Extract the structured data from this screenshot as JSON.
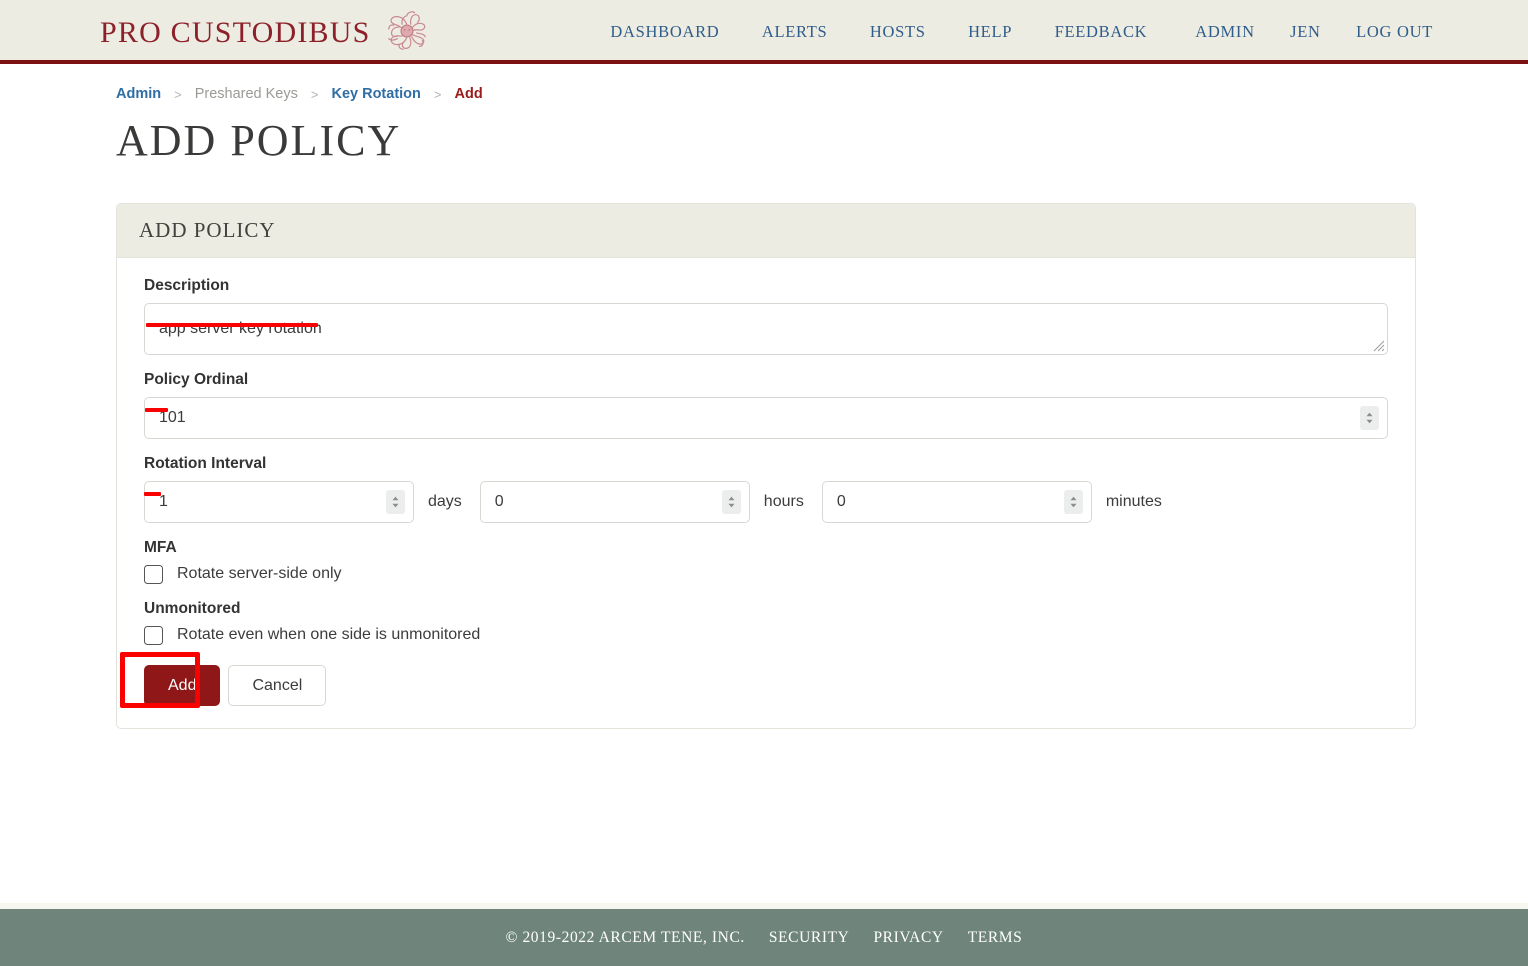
{
  "header": {
    "brand_name": "PRO CUSTODIBUS",
    "logo_icon": "medusa-head-icon",
    "nav_main": [
      {
        "label": "DASHBOARD"
      },
      {
        "label": "ALERTS"
      },
      {
        "label": "HOSTS"
      },
      {
        "label": "HELP"
      },
      {
        "label": "FEEDBACK"
      }
    ],
    "nav_user": [
      {
        "label": "ADMIN"
      },
      {
        "label": "JEN"
      },
      {
        "label": "LOG OUT"
      }
    ],
    "colors": {
      "background": "#edece3",
      "accent": "#7b1113",
      "brand_text": "#8d2129",
      "nav_link": "#2f5d8a"
    }
  },
  "breadcrumb": {
    "separator": ">",
    "items": [
      {
        "label": "Admin",
        "style": "link"
      },
      {
        "label": "Preshared Keys",
        "style": "plain"
      },
      {
        "label": "Key Rotation",
        "style": "link"
      },
      {
        "label": "Add",
        "style": "current"
      }
    ]
  },
  "page": {
    "title": "ADD POLICY"
  },
  "card": {
    "header_title": "ADD POLICY",
    "description": {
      "label": "Description",
      "value": "app server key rotation",
      "placeholder": ""
    },
    "policy_ordinal": {
      "label": "Policy Ordinal",
      "value": "101",
      "placeholder": ""
    },
    "rotation_interval": {
      "label": "Rotation Interval",
      "fields": [
        {
          "value": "1",
          "unit": "days"
        },
        {
          "value": "0",
          "unit": "hours"
        },
        {
          "value": "0",
          "unit": "minutes"
        }
      ]
    },
    "mfa": {
      "label": "MFA",
      "checkbox_label": "Rotate server-side only",
      "checked": false
    },
    "unmonitored": {
      "label": "Unmonitored",
      "checkbox_label": "Rotate even when one side is unmonitored",
      "checked": false
    },
    "buttons": {
      "submit_label": "Add",
      "cancel_label": "Cancel"
    }
  },
  "annotations": {
    "color": "#fb0000",
    "highlight_target": "Add",
    "underline_targets": [
      "app server key rotation",
      "101",
      "1"
    ]
  },
  "footer": {
    "copyright": "© 2019-2022 ARCEM TENE, INC.",
    "links": [
      {
        "label": "SECURITY"
      },
      {
        "label": "PRIVACY"
      },
      {
        "label": "TERMS"
      }
    ],
    "background": "#6f857c"
  }
}
